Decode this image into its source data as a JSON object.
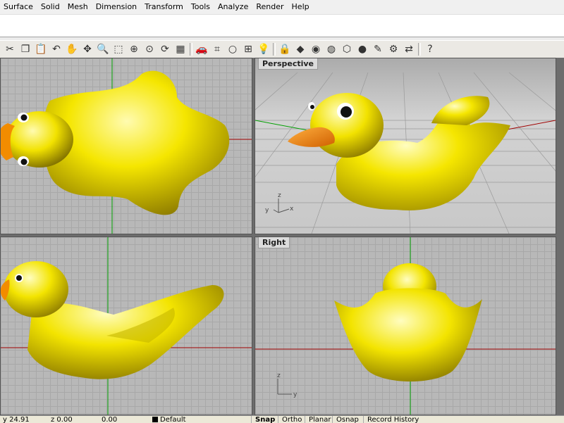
{
  "menu": [
    "Surface",
    "Solid",
    "Mesh",
    "Dimension",
    "Transform",
    "Tools",
    "Analyze",
    "Render",
    "Help"
  ],
  "toolbar_icons": [
    "cut-icon",
    "copy-icon",
    "paste-icon",
    "undo-icon",
    "pan-hand-icon",
    "move-icon",
    "zoom-icon",
    "zoom-window-icon",
    "zoom-extents-icon",
    "zoom-selected-icon",
    "rotate-view-icon",
    "four-viewports-icon",
    "car-icon",
    "grid-icon",
    "circle-icon",
    "snap-icon",
    "light-bulb-icon",
    "lock-icon",
    "color-shader-icon",
    "color-wheel-icon",
    "sphere-wire-icon",
    "mesh-box-icon",
    "render-sphere-icon",
    "paint-icon",
    "settings-gear-icon",
    "transform-icon",
    "help-icon"
  ],
  "toolbar_glyphs": [
    "✂",
    "❐",
    "📋",
    "↶",
    "✋",
    "✥",
    "🔍",
    "⬚",
    "⊕",
    "⊙",
    "⟳",
    "▦",
    "🚗",
    "⌗",
    "○",
    "⊞",
    "💡",
    "🔒",
    "◆",
    "◉",
    "◍",
    "⬡",
    "●",
    "✎",
    "⚙",
    "⇄",
    "?"
  ],
  "viewports": {
    "perspective_label": "Perspective",
    "right_label": "Right",
    "axis_z": "z",
    "axis_x": "x",
    "axis_y": "y"
  },
  "status": {
    "x": "y 24.91",
    "y": "z 0.00",
    "z": "0.00",
    "layer": "Default",
    "snap": "Snap",
    "ortho": "Ortho",
    "planar": "Planar",
    "osnap": "Osnap",
    "record": "Record History"
  },
  "colors": {
    "duck_yellow": "#f2e600",
    "beak_orange": "#f28c00",
    "viewport_bg": "#b8b8b8",
    "axis_red": "#b00000",
    "axis_green": "#009000"
  }
}
